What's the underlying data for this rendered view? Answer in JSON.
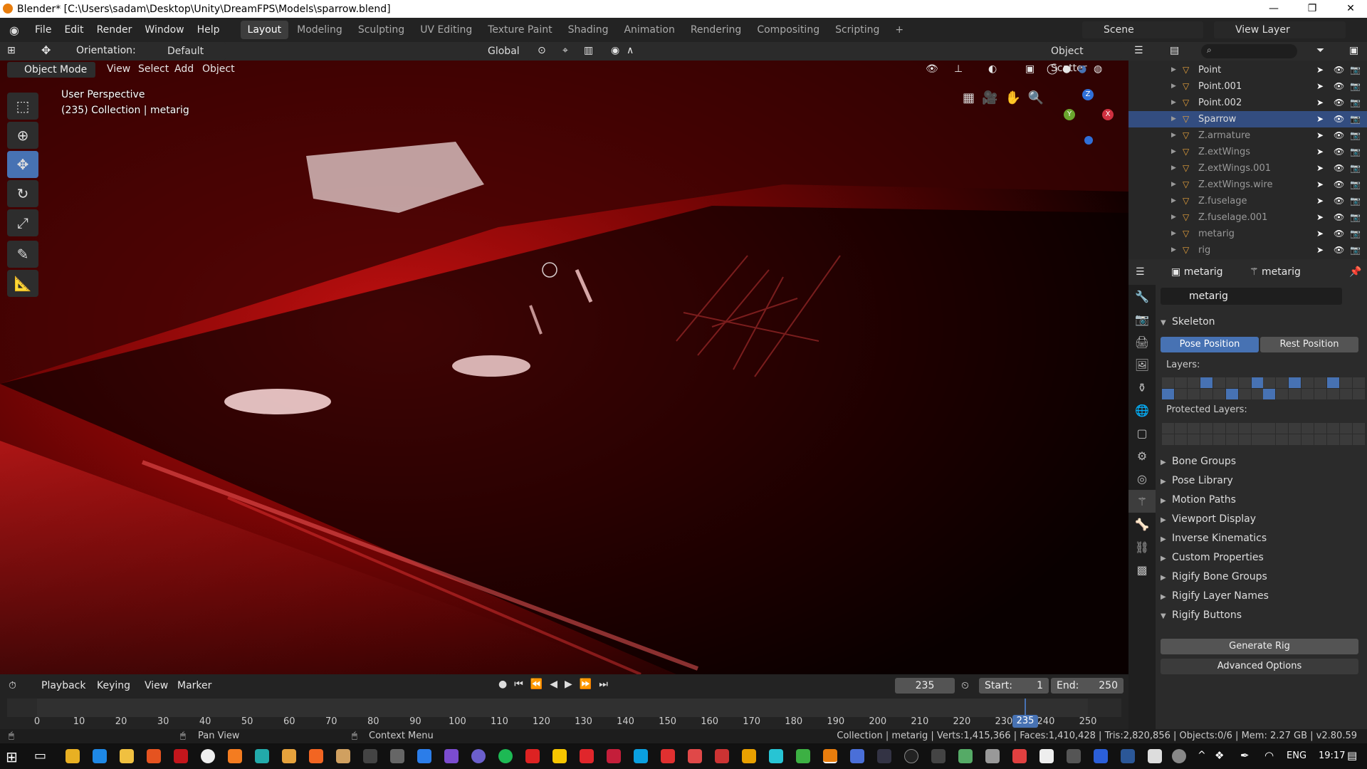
{
  "window": {
    "title": "Blender* [C:\\Users\\sadam\\Desktop\\Unity\\DreamFPS\\Models\\sparrow.blend]",
    "minimize": "—",
    "maximize": "❐",
    "close": "✕"
  },
  "menus": [
    "File",
    "Edit",
    "Render",
    "Window",
    "Help"
  ],
  "workspaces": [
    "Layout",
    "Modeling",
    "Sculpting",
    "UV Editing",
    "Texture Paint",
    "Shading",
    "Animation",
    "Rendering",
    "Compositing",
    "Scripting",
    "+"
  ],
  "scene": "Scene",
  "view_layer": "View Layer",
  "tool_header": {
    "orientation_label": "Orientation:",
    "orientation_value": "Default",
    "transform_orientation": "Global",
    "object_scatter": "Object Scatter"
  },
  "view_header": {
    "mode": "Object Mode",
    "view": "View",
    "select": "Select",
    "add": "Add",
    "object": "Object"
  },
  "viewport": {
    "perspective": "User Perspective",
    "collection": "(235) Collection | metarig",
    "gizmo_z": "Z",
    "gizmo_x": "X",
    "gizmo_y": "Y"
  },
  "outliner": {
    "rows": [
      {
        "name": "Point",
        "selected": false,
        "dim": false
      },
      {
        "name": "Point.001",
        "selected": false,
        "dim": false
      },
      {
        "name": "Point.002",
        "selected": false,
        "dim": false
      },
      {
        "name": "Sparrow",
        "selected": true,
        "dim": false
      },
      {
        "name": "Z.armature",
        "selected": false,
        "dim": true
      },
      {
        "name": "Z.extWings",
        "selected": false,
        "dim": true
      },
      {
        "name": "Z.extWings.001",
        "selected": false,
        "dim": true
      },
      {
        "name": "Z.extWings.wire",
        "selected": false,
        "dim": true
      },
      {
        "name": "Z.fuselage",
        "selected": false,
        "dim": true
      },
      {
        "name": "Z.fuselage.001",
        "selected": false,
        "dim": true
      },
      {
        "name": "metarig",
        "selected": false,
        "dim": true
      },
      {
        "name": "rig",
        "selected": false,
        "dim": true
      }
    ]
  },
  "properties": {
    "breadcrumb_object": "metarig",
    "breadcrumb_data": "metarig",
    "datablock": "metarig",
    "skeleton_title": "Skeleton",
    "pose_position": "Pose Position",
    "rest_position": "Rest Position",
    "layers_label": "Layers:",
    "protected_layers_label": "Protected Layers:",
    "panels": [
      "Bone Groups",
      "Pose Library",
      "Motion Paths",
      "Viewport Display",
      "Inverse Kinematics",
      "Custom Properties",
      "Rigify Bone Groups",
      "Rigify Layer Names"
    ],
    "rigify_buttons": "Rigify Buttons",
    "generate_rig": "Generate Rig",
    "advanced_options": "Advanced Options"
  },
  "timeline": {
    "playback": "Playback",
    "keying": "Keying",
    "view": "View",
    "marker": "Marker",
    "current_frame": "235",
    "start_label": "Start:",
    "start": "1",
    "end_label": "End:",
    "end": "250",
    "ticks": [
      "0",
      "10",
      "20",
      "30",
      "40",
      "50",
      "60",
      "70",
      "80",
      "90",
      "100",
      "110",
      "120",
      "130",
      "140",
      "150",
      "160",
      "170",
      "180",
      "190",
      "200",
      "210",
      "220",
      "230",
      "240",
      "250"
    ],
    "playhead": "235"
  },
  "statusbar": {
    "pan_view": "Pan View",
    "context_menu": "Context Menu",
    "stats": "Collection | metarig | Verts:1,415,366 | Faces:1,410,428 | Tris:2,820,856 | Objects:0/6 | Mem: 2.27 GB | v2.80.59"
  },
  "taskbar": {
    "language": "ENG",
    "time": "19:17"
  },
  "colors": {
    "accent": "#4772b3",
    "selected_row": "#334d80",
    "blender_orange": "#e87d0d"
  }
}
